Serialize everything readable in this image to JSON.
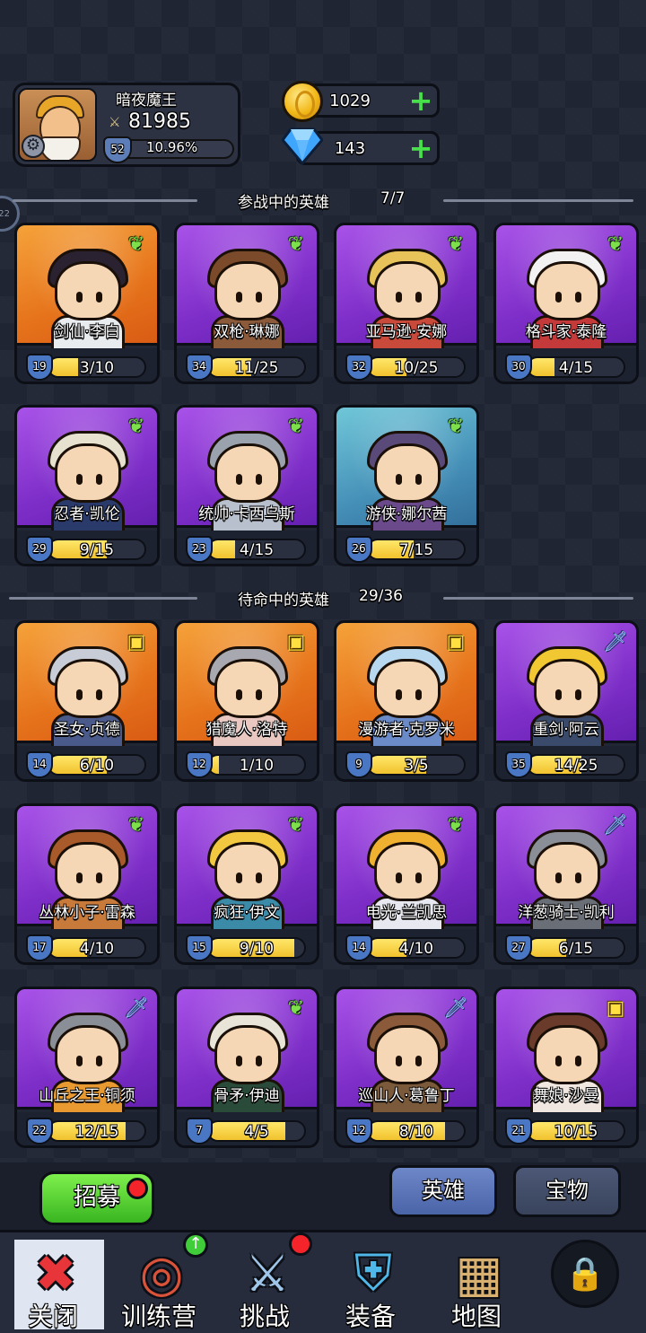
{
  "player": {
    "name": "暗夜魔王",
    "power": "81985",
    "level": "52",
    "exp_percent": "10.96%",
    "exp_fraction": 0.1096
  },
  "currency": {
    "gold": "1029",
    "gems": "143"
  },
  "side_tab": "22",
  "active_section": {
    "label": "参战中的英雄",
    "count": "7/7"
  },
  "standby_section": {
    "label": "待命中的英雄",
    "count": "29/36"
  },
  "active_heroes": [
    {
      "name": "剑仙·李白",
      "level": "19",
      "progress": "3/10",
      "fill": 0.3,
      "bg": "orange",
      "badge": "leaf",
      "hair": "#2a2230",
      "body": "#e9ecef"
    },
    {
      "name": "双枪·琳娜",
      "level": "34",
      "progress": "11/25",
      "fill": 0.44,
      "bg": "purple",
      "badge": "leaf",
      "hair": "#7b4a2a",
      "body": "#8a5a3a"
    },
    {
      "name": "亚马逊·安娜",
      "level": "32",
      "progress": "10/25",
      "fill": 0.4,
      "bg": "purple",
      "badge": "leaf",
      "hair": "#e8c35a",
      "body": "#c94a3a"
    },
    {
      "name": "格斗家·泰隆",
      "level": "30",
      "progress": "4/15",
      "fill": 0.27,
      "bg": "purple",
      "badge": "leaf",
      "hair": "#f2f2f2",
      "body": "#c43a3a"
    },
    {
      "name": "忍者·凯伦",
      "level": "29",
      "progress": "9/15",
      "fill": 0.6,
      "bg": "purple",
      "badge": "leaf",
      "hair": "#e6e2cf",
      "body": "#2a3a6a"
    },
    {
      "name": "统帅·卡西乌斯",
      "level": "23",
      "progress": "4/15",
      "fill": 0.27,
      "bg": "purple",
      "badge": "leaf",
      "hair": "#9aa2ad",
      "body": "#b7c0cc"
    },
    {
      "name": "游侠·娜尔茜",
      "level": "26",
      "progress": "7/15",
      "fill": 0.47,
      "bg": "blue",
      "badge": "leaf",
      "hair": "#5a4a7a",
      "body": "#6a4a8a"
    }
  ],
  "standby_heroes": [
    {
      "name": "圣女·贞德",
      "level": "14",
      "progress": "6/10",
      "fill": 0.6,
      "bg": "orange",
      "badge": "book",
      "hair": "#c8ccd6",
      "body": "#4a5a8a"
    },
    {
      "name": "猎魔人·洛特",
      "level": "12",
      "progress": "1/10",
      "fill": 0.1,
      "bg": "orange",
      "badge": "book",
      "hair": "#a8a8b0",
      "body": "#e8c8c0"
    },
    {
      "name": "漫游者·克罗米",
      "level": "9",
      "progress": "3/5",
      "fill": 0.6,
      "bg": "orange",
      "badge": "book",
      "hair": "#b8d8f0",
      "body": "#6a8ac8"
    },
    {
      "name": "重剑·阿云",
      "level": "35",
      "progress": "14/25",
      "fill": 0.56,
      "bg": "purple",
      "badge": "sword",
      "hair": "#f2c832",
      "body": "#3a4a6a"
    },
    {
      "name": "丛林小子·雷森",
      "level": "17",
      "progress": "4/10",
      "fill": 0.4,
      "bg": "purple",
      "badge": "leaf",
      "hair": "#a85a2a",
      "body": "#c87a3a"
    },
    {
      "name": "疯狂·伊文",
      "level": "15",
      "progress": "9/10",
      "fill": 0.9,
      "bg": "purple",
      "badge": "leaf",
      "hair": "#f2c840",
      "body": "#3a8aa8"
    },
    {
      "name": "电光·兰凯思",
      "level": "14",
      "progress": "4/10",
      "fill": 0.4,
      "bg": "purple",
      "badge": "leaf",
      "hair": "#f0b030",
      "body": "#e8e8f0"
    },
    {
      "name": "洋葱骑士·凯利",
      "level": "27",
      "progress": "6/15",
      "fill": 0.4,
      "bg": "purple",
      "badge": "sword",
      "hair": "#8a8e96",
      "body": "#6a6e76"
    },
    {
      "name": "山丘之王·铜须",
      "level": "22",
      "progress": "12/15",
      "fill": 0.8,
      "bg": "purple",
      "badge": "sword",
      "hair": "#8a8e96",
      "body": "#e89a30"
    },
    {
      "name": "骨矛·伊迪",
      "level": "7",
      "progress": "4/5",
      "fill": 0.8,
      "bg": "purple",
      "badge": "leaf",
      "hair": "#e8e4d8",
      "body": "#2a4a3a"
    },
    {
      "name": "巡山人·葛鲁丁",
      "level": "12",
      "progress": "8/10",
      "fill": 0.8,
      "bg": "purple",
      "badge": "sword",
      "hair": "#8a5a3a",
      "body": "#7a5a3a"
    },
    {
      "name": "舞娘·沙曼",
      "level": "21",
      "progress": "10/15",
      "fill": 0.67,
      "bg": "purple",
      "badge": "book",
      "hair": "#6a3a2a",
      "body": "#f0e8e0"
    }
  ],
  "buttons": {
    "recruit": "招募",
    "tab_heroes": "英雄",
    "tab_treasure": "宝物"
  },
  "nav": [
    {
      "label": "关闭",
      "icon": "close-icon",
      "glyph": "✖",
      "color": "#e8353a"
    },
    {
      "label": "训练营",
      "icon": "target-icon",
      "glyph": "◎",
      "color": "#d9523a"
    },
    {
      "label": "挑战",
      "icon": "sword-icon",
      "glyph": "⚔",
      "color": "#9fc6e8"
    },
    {
      "label": "装备",
      "icon": "armor-icon",
      "glyph": "⛨",
      "color": "#4fb8e8"
    },
    {
      "label": "地图",
      "icon": "map-icon",
      "glyph": "▦",
      "color": "#d8b070"
    },
    {
      "label": "",
      "icon": "lock-icon",
      "glyph": "🔒",
      "color": "#aeb4bf"
    }
  ]
}
